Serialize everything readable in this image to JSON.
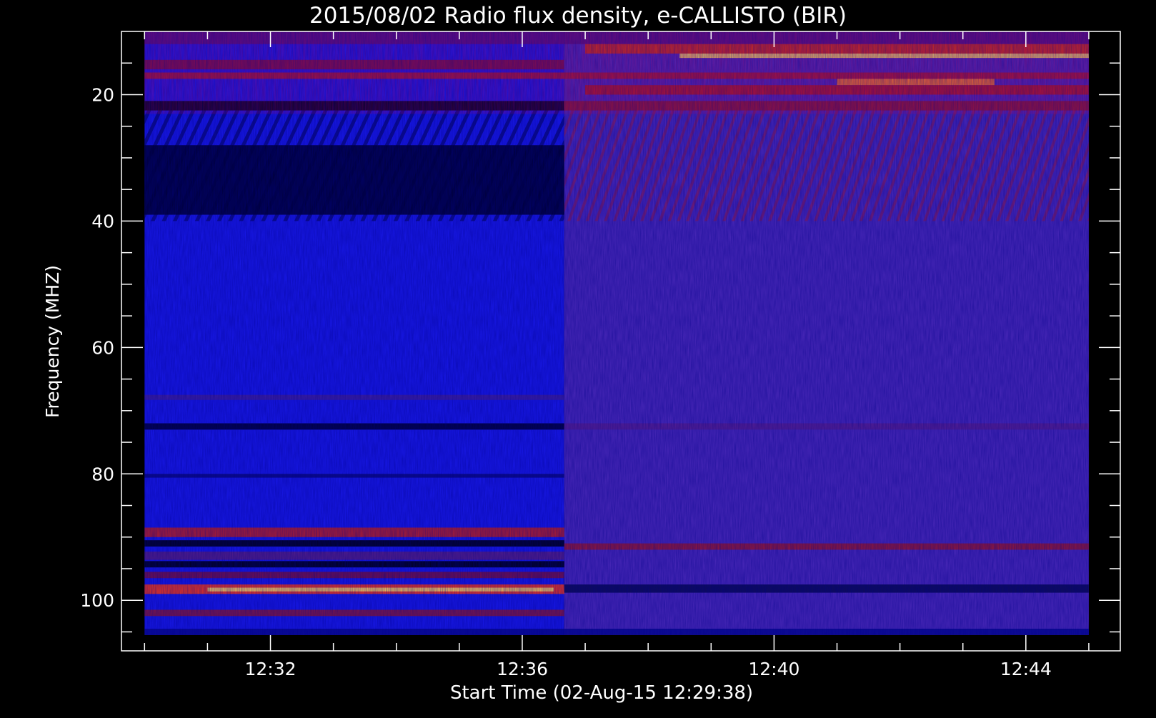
{
  "chart_data": {
    "type": "heatmap",
    "title": "2015/08/02  Radio flux density, e-CALLISTO (BIR)",
    "xlabel": "Start Time (02-Aug-15 12:29:38)",
    "ylabel": "Frequency (MHZ)",
    "xlim": [
      "12:29:38",
      "12:45:30"
    ],
    "ylim": [
      10,
      108
    ],
    "y_inverted": true,
    "data_time_range": [
      "12:30:00",
      "12:45:00"
    ],
    "data_freq_range": [
      10,
      105.5
    ],
    "x_major_ticks": [
      {
        "t": "12:32",
        "label": "12:32"
      },
      {
        "t": "12:36",
        "label": "12:36"
      },
      {
        "t": "12:40",
        "label": "12:40"
      },
      {
        "t": "12:44",
        "label": "12:44"
      }
    ],
    "x_minor_ticks": [
      "12:30",
      "12:31",
      "12:33",
      "12:34",
      "12:35",
      "12:37",
      "12:38",
      "12:39",
      "12:41",
      "12:42",
      "12:43",
      "12:45"
    ],
    "y_major_ticks": [
      {
        "v": 20,
        "label": "20"
      },
      {
        "v": 40,
        "label": "40"
      },
      {
        "v": 60,
        "label": "60"
      },
      {
        "v": 80,
        "label": "80"
      },
      {
        "v": 100,
        "label": "100"
      }
    ],
    "y_minor_ticks": [
      15,
      25,
      30,
      35,
      45,
      50,
      55,
      65,
      70,
      75,
      85,
      90,
      95,
      105
    ],
    "calibration_change_time": "12:36:40",
    "colors": {
      "background": "#000000",
      "low_blue": "#1818e8",
      "purple_after_change": "#4a28b8",
      "dark": "#000020",
      "red": "#c01818",
      "orange": "#ff6010",
      "yellow": "#ffe060"
    },
    "bands": [
      {
        "f": [
          10,
          12
        ],
        "from": "12:30:00",
        "to": "12:45:00",
        "color": "#501080"
      },
      {
        "f": [
          12,
          13.5
        ],
        "from": "12:37:00",
        "to": "12:45:00",
        "color": "#d03010"
      },
      {
        "f": [
          13.5,
          14.2
        ],
        "from": "12:38:30",
        "to": "12:45:00",
        "color": "#ffe060"
      },
      {
        "f": [
          14.5,
          16
        ],
        "from": "12:30:00",
        "to": "12:36:40",
        "color": "#7a1040"
      },
      {
        "f": [
          16.5,
          17.5
        ],
        "from": "12:30:00",
        "to": "12:45:00",
        "color": "#a81830"
      },
      {
        "f": [
          17.5,
          18.5
        ],
        "from": "12:41:00",
        "to": "12:43:30",
        "color": "#ff8020"
      },
      {
        "f": [
          18.5,
          20
        ],
        "from": "12:37:00",
        "to": "12:45:00",
        "color": "#b01820"
      },
      {
        "f": [
          21,
          22.5
        ],
        "from": "12:30:00",
        "to": "12:36:40",
        "color": "#000010"
      },
      {
        "f": [
          21,
          22.5
        ],
        "from": "12:36:40",
        "to": "12:45:00",
        "color": "#8a1830"
      },
      {
        "f": [
          28,
          39
        ],
        "from": "12:30:00",
        "to": "12:36:40",
        "color": "#000030"
      },
      {
        "f": [
          67.5,
          68.3
        ],
        "from": "12:30:00",
        "to": "12:36:40",
        "color": "#4020a0"
      },
      {
        "f": [
          72,
          73
        ],
        "from": "12:30:00",
        "to": "12:36:40",
        "color": "#000030"
      },
      {
        "f": [
          72,
          73
        ],
        "from": "12:36:40",
        "to": "12:45:00",
        "color": "#5a2090"
      },
      {
        "f": [
          80,
          80.6
        ],
        "from": "12:30:00",
        "to": "12:36:40",
        "color": "#0a0a80"
      },
      {
        "f": [
          88.5,
          90
        ],
        "from": "12:30:00",
        "to": "12:36:40",
        "color": "#c02020"
      },
      {
        "f": [
          90.5,
          91.5
        ],
        "from": "12:30:00",
        "to": "12:36:40",
        "color": "#000010"
      },
      {
        "f": [
          91,
          92
        ],
        "from": "12:36:40",
        "to": "12:45:00",
        "color": "#9a1830"
      },
      {
        "f": [
          92.3,
          93.6
        ],
        "from": "12:30:00",
        "to": "12:36:40",
        "color": "#5a2080"
      },
      {
        "f": [
          93.8,
          94.8
        ],
        "from": "12:30:00",
        "to": "12:36:40",
        "color": "#000010"
      },
      {
        "f": [
          95.5,
          96.5
        ],
        "from": "12:30:00",
        "to": "12:36:40",
        "color": "#7a1040"
      },
      {
        "f": [
          97.5,
          99
        ],
        "from": "12:30:00",
        "to": "12:36:40",
        "color": "#ff3a10"
      },
      {
        "f": [
          98,
          98.6
        ],
        "from": "12:31:00",
        "to": "12:36:30",
        "color": "#ffd060"
      },
      {
        "f": [
          97.5,
          98.8
        ],
        "from": "12:36:40",
        "to": "12:45:00",
        "color": "#0a0a50"
      },
      {
        "f": [
          101.5,
          102.5
        ],
        "from": "12:30:00",
        "to": "12:36:40",
        "color": "#8a1838"
      },
      {
        "f": [
          104.5,
          105.5
        ],
        "from": "12:30:00",
        "to": "12:45:00",
        "color": "#0a0a90"
      }
    ]
  }
}
